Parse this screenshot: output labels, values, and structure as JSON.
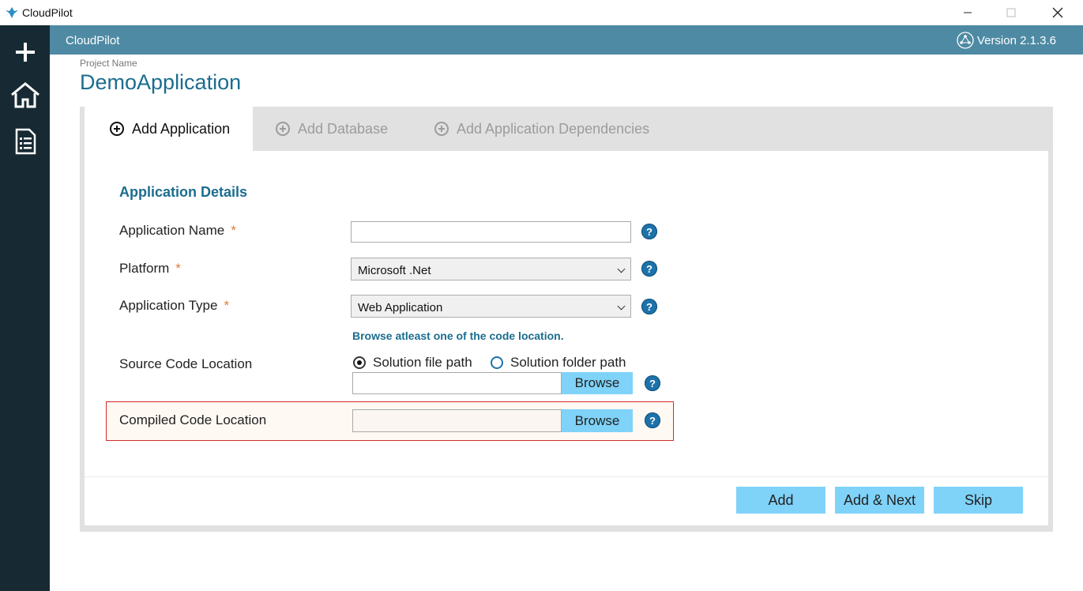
{
  "window": {
    "title": "CloudPilot"
  },
  "header": {
    "title": "CloudPilot",
    "version": "Version 2.1.3.6"
  },
  "sidebar": {
    "icons": [
      "add-icon",
      "home-icon",
      "report-icon"
    ]
  },
  "project": {
    "label": "Project Name",
    "name": "DemoApplication"
  },
  "tabs": [
    {
      "label": "Add Application",
      "active": true
    },
    {
      "label": "Add Database",
      "active": false
    },
    {
      "label": "Add Application Dependencies",
      "active": false
    }
  ],
  "form": {
    "section_title": "Application Details",
    "app_name": {
      "label": "Application Name",
      "required": "*",
      "value": ""
    },
    "platform": {
      "label": "Platform",
      "required": "*",
      "value": "Microsoft .Net"
    },
    "app_type": {
      "label": "Application Type",
      "required": "*",
      "value": "Web Application"
    },
    "browse_hint": "Browse atleast one of the code location.",
    "source_code": {
      "label": "Source Code Location",
      "radio_file": "Solution file path",
      "radio_folder": "Solution folder path",
      "selected": "Solution file path",
      "value": "",
      "browse": "Browse"
    },
    "compiled_code": {
      "label": "Compiled Code Location",
      "value": "",
      "browse": "Browse"
    },
    "help_glyph": "?"
  },
  "actions": {
    "add": "Add",
    "add_next": "Add & Next",
    "skip": "Skip"
  },
  "colors": {
    "header": "#4e8aa3",
    "sidebar": "#172a33",
    "accent": "#1b6d8e",
    "button": "#7fd2f8",
    "highlight": "#d62b2b"
  }
}
